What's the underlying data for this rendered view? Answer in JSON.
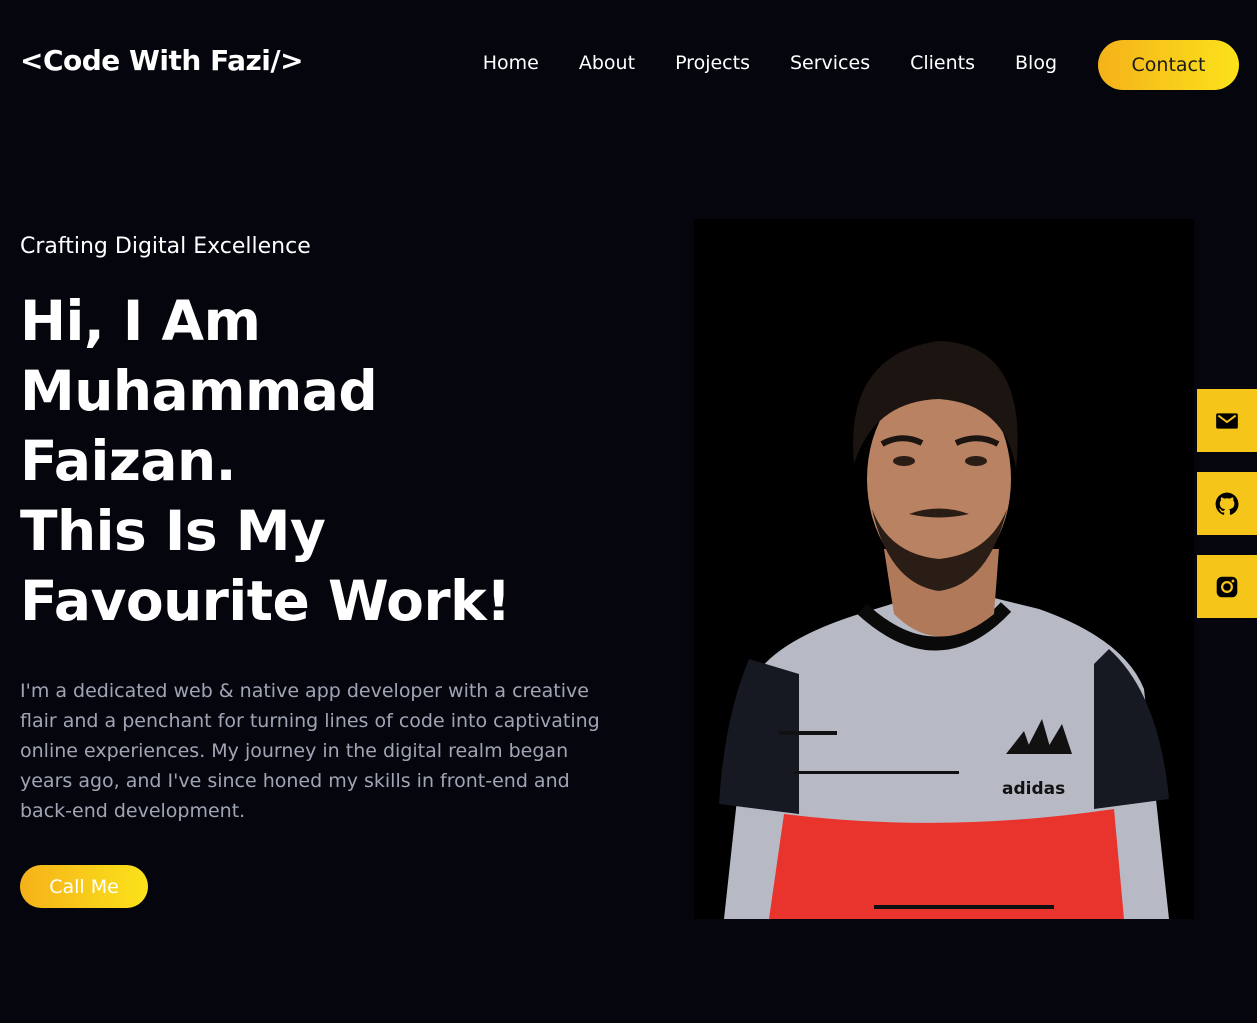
{
  "header": {
    "logo": "<Code With Fazi/>",
    "nav": [
      "Home",
      "About",
      "Projects",
      "Services",
      "Clients",
      "Blog"
    ],
    "contact_label": "Contact"
  },
  "hero": {
    "tagline": "Crafting Digital Excellence",
    "headline_lines": [
      "Hi, I Am",
      "Muhammad",
      "Faizan.",
      "This Is My",
      "Favourite Work!"
    ],
    "intro": "I'm a dedicated web & native app developer with a creative flair and a penchant for turning lines of code into captivating online experiences. My journey in the digital realm began years ago, and I've since honed my skills in front-end and back-end development.",
    "cta_label": "Call Me",
    "portrait_brand": "adidas"
  },
  "social": {
    "icons": [
      "mail-icon",
      "github-icon",
      "instagram-icon"
    ]
  },
  "colors": {
    "background": "#05060d",
    "accent_start": "#f5b21a",
    "accent_end": "#fbe21a",
    "muted_text": "#a0a5b5"
  }
}
